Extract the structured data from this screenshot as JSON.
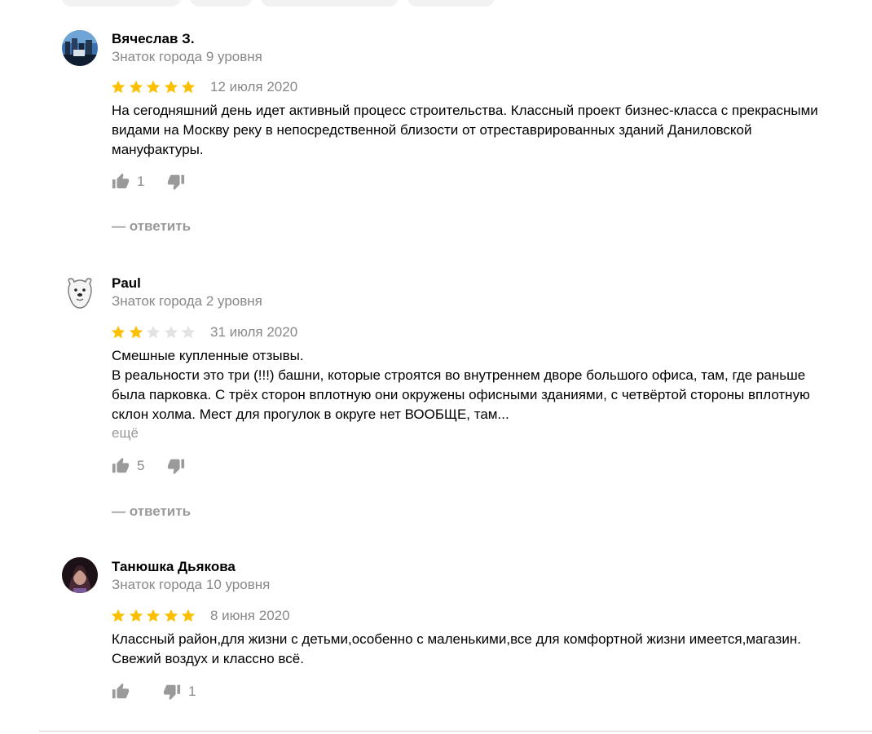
{
  "colors": {
    "star_on": "#fcc000",
    "star_off": "#e3e3e3",
    "muted": "#888888",
    "vote_icon": "#9a9a9a"
  },
  "reviews": [
    {
      "author": "Вячеслав З.",
      "level": "Знаток города 9 уровня",
      "rating": 5,
      "date": "12 июля 2020",
      "text": [
        "На сегодняшний день идет активный процесс строительства. Классный проект бизнес-класса с прекрасными видами на Москву реку в непосредственной близости от отреставрированных зданий Даниловской мануфактуры."
      ],
      "likes": "1",
      "dislikes": "",
      "reply_label": "— ответить",
      "avatar_icon": "city-photo-avatar"
    },
    {
      "author": "Paul",
      "level": "Знаток города 2 уровня",
      "rating": 2,
      "date": "31 июля 2020",
      "text": [
        "Смешные купленные отзывы.",
        "В реальности это три (!!!) башни, которые строятся во внутреннем дворе большого офиса, там, где раньше была парковка. С трёх сторон вплотную они окружены офисными зданиями, с четвёртой стороны вплотную склон холма. Мест для прогулок в округе нет ВООБЩЕ, там..."
      ],
      "more_label": "ещё",
      "likes": "5",
      "dislikes": "",
      "reply_label": "— ответить",
      "avatar_icon": "polar-bear-avatar"
    },
    {
      "author": "Танюшка Дьякова",
      "level": "Знаток города 10 уровня",
      "rating": 5,
      "date": "8 июня 2020",
      "text": [
        "Классный район,для жизни с детьми,особенно с маленькими,все для комфортной жизни имеется,магазин. Свежий воздух и классно всё."
      ],
      "likes": "",
      "dislikes": "1",
      "avatar_icon": "woman-photo-avatar"
    }
  ]
}
